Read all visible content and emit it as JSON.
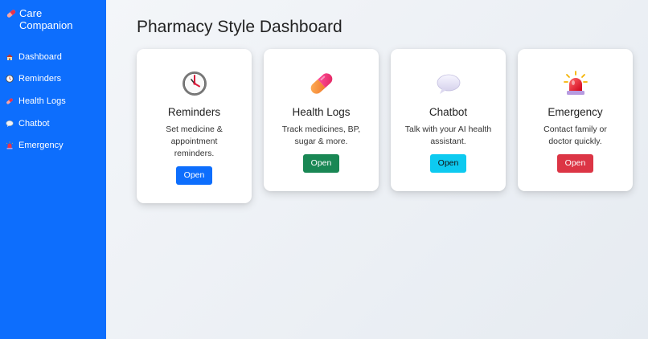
{
  "sidebar": {
    "brand": {
      "icon": "pill-icon",
      "title": "Care Companion"
    },
    "items": [
      {
        "icon": "house-icon",
        "label": "Dashboard"
      },
      {
        "icon": "clock-icon",
        "label": "Reminders"
      },
      {
        "icon": "pill-icon",
        "label": "Health Logs"
      },
      {
        "icon": "speech-bubble-icon",
        "label": "Chatbot"
      },
      {
        "icon": "siren-icon",
        "label": "Emergency"
      }
    ],
    "background": "#0d6efd"
  },
  "main": {
    "title": "Pharmacy Style Dashboard",
    "cards": [
      {
        "icon": "clock-icon",
        "title": "Reminders",
        "description": "Set medicine & appointment reminders.",
        "button": "Open",
        "button_color": "#0d6efd"
      },
      {
        "icon": "pill-icon",
        "title": "Health Logs",
        "description": "Track medicines, BP, sugar & more.",
        "button": "Open",
        "button_color": "#198754"
      },
      {
        "icon": "speech-bubble-icon",
        "title": "Chatbot",
        "description": "Talk with your AI health assistant.",
        "button": "Open",
        "button_color": "#0dcaf0"
      },
      {
        "icon": "siren-icon",
        "title": "Emergency",
        "description": "Contact family or doctor quickly.",
        "button": "Open",
        "button_color": "#dc3545"
      }
    ]
  }
}
